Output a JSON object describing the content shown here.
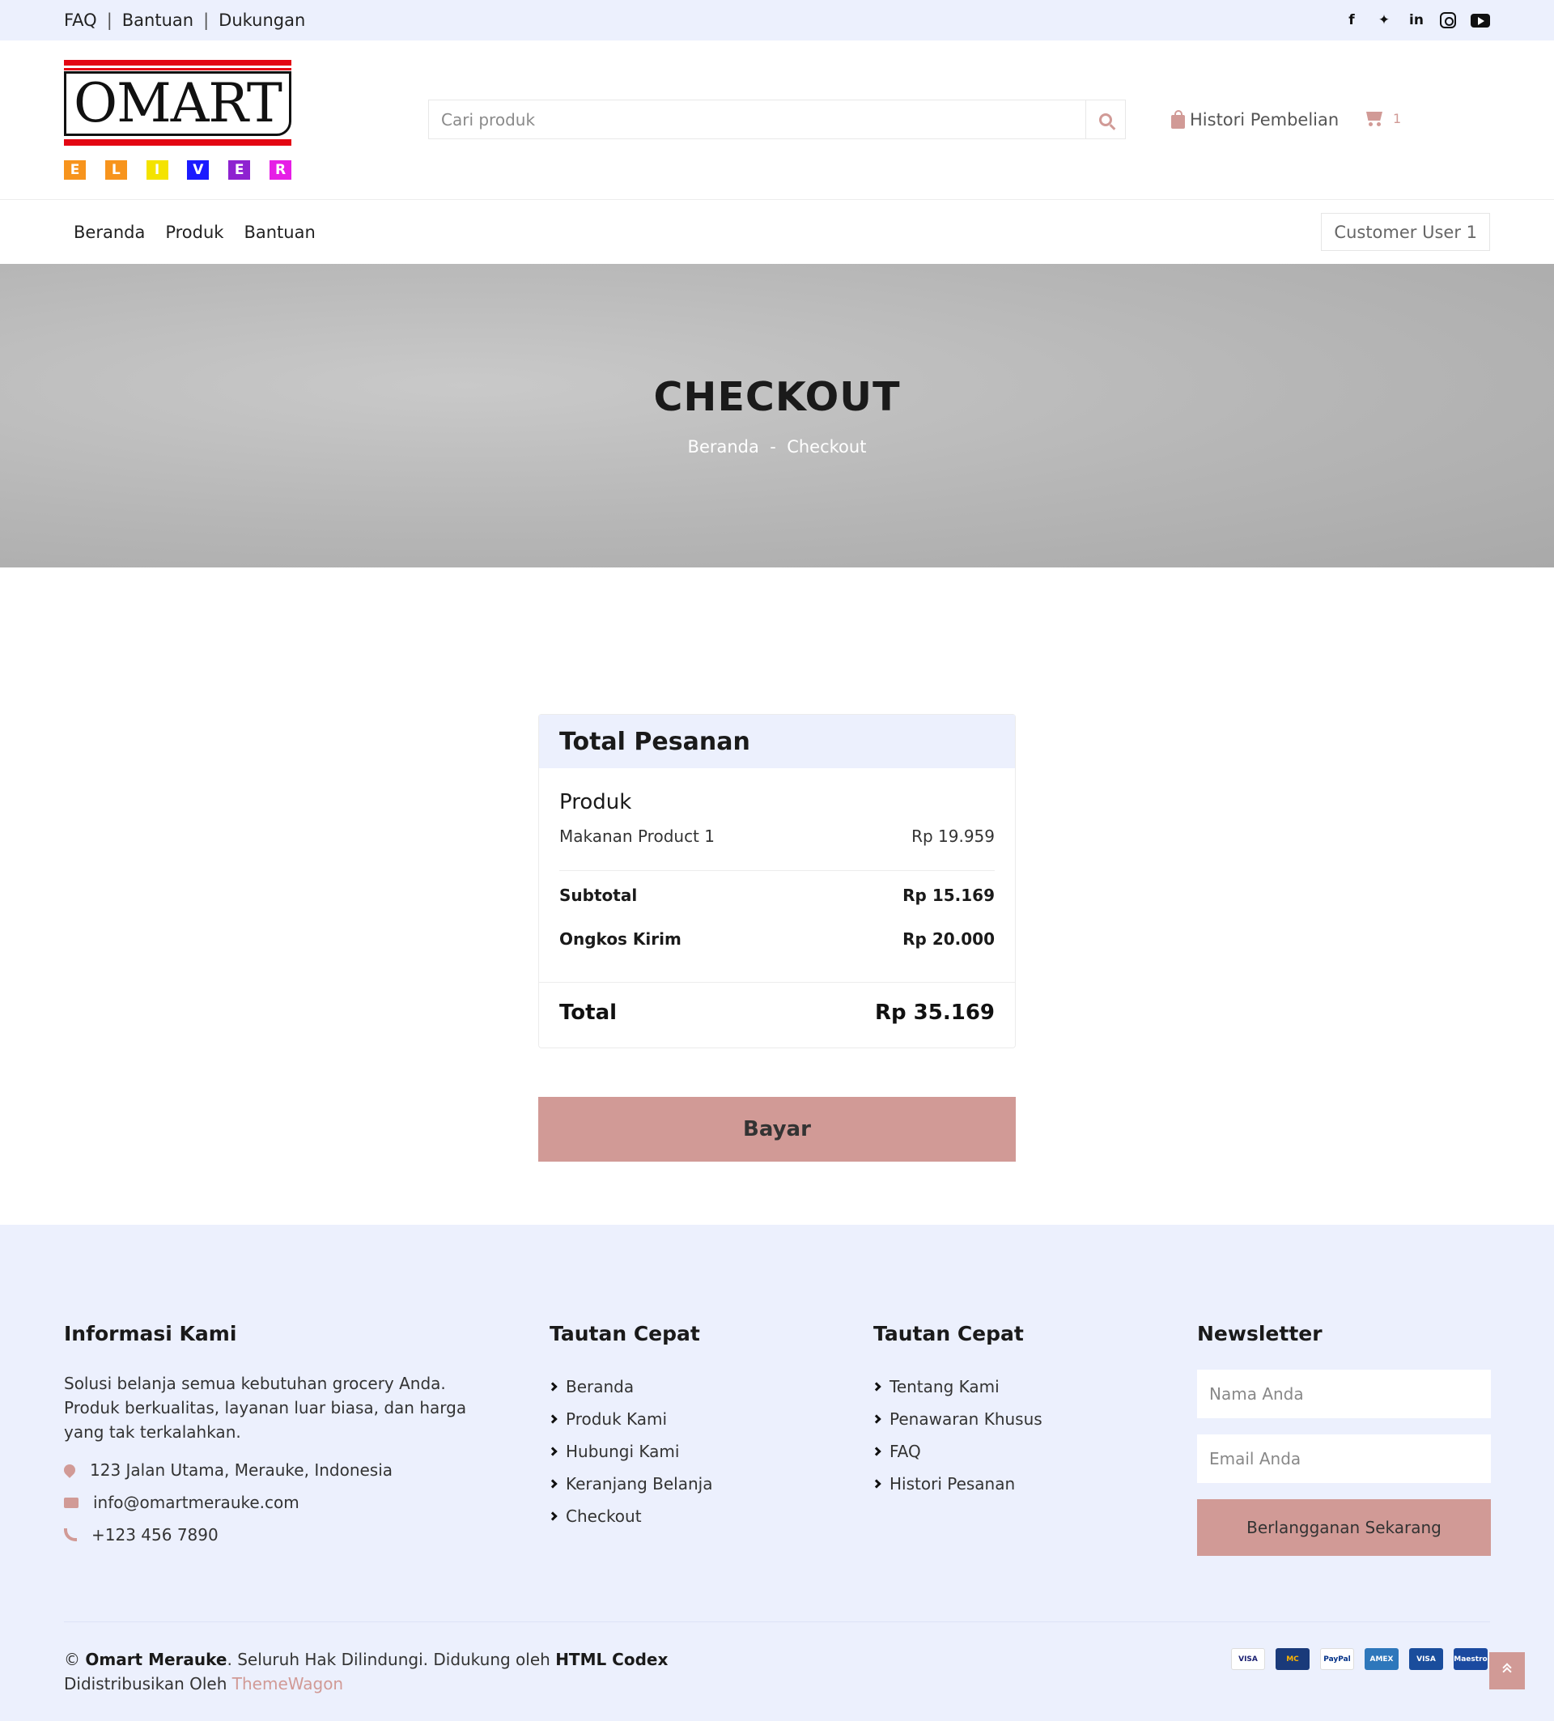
{
  "topbar": {
    "links": [
      "FAQ",
      "Bantuan",
      "Dukungan"
    ],
    "social_icons": [
      "facebook-icon",
      "twitter-icon",
      "linkedin-icon",
      "instagram-icon",
      "youtube-icon"
    ]
  },
  "logo": {
    "word": "OMART",
    "letters": [
      "E",
      "L",
      "I",
      "V",
      "E",
      "R"
    ],
    "letter_colors": [
      "#f7941d",
      "#f7941d",
      "#f4e300",
      "#1a1aff",
      "#8e22d0",
      "#e61ee6"
    ]
  },
  "search": {
    "placeholder": "Cari produk"
  },
  "header": {
    "history_label": "Histori Pembelian",
    "cart_count": "1"
  },
  "nav": {
    "links": [
      "Beranda",
      "Produk",
      "Bantuan"
    ],
    "user": "Customer User 1"
  },
  "hero": {
    "title": "CHECKOUT",
    "breadcrumb": [
      "Beranda",
      "-",
      "Checkout"
    ]
  },
  "order": {
    "title": "Total Pesanan",
    "product_heading": "Produk",
    "items": [
      {
        "name": "Makanan Product 1",
        "price": "Rp 19.959"
      }
    ],
    "subtotal_label": "Subtotal",
    "subtotal_value": "Rp 15.169",
    "shipping_label": "Ongkos Kirim",
    "shipping_value": "Rp 20.000",
    "total_label": "Total",
    "total_value": "Rp 35.169",
    "pay_label": "Bayar"
  },
  "footer": {
    "info": {
      "title": "Informasi Kami",
      "description": "Solusi belanja semua kebutuhan grocery Anda. Produk berkualitas, layanan luar biasa, dan harga yang tak terkalahkan.",
      "address": "123 Jalan Utama, Merauke, Indonesia",
      "email": "info@omartmerauke.com",
      "phone": "+123 456 7890"
    },
    "quick1": {
      "title": "Tautan Cepat",
      "links": [
        "Beranda",
        "Produk Kami",
        "Hubungi Kami",
        "Keranjang Belanja",
        "Checkout"
      ]
    },
    "quick2": {
      "title": "Tautan Cepat",
      "links": [
        "Tentang Kami",
        "Penawaran Khusus",
        "FAQ",
        "Histori Pesanan"
      ]
    },
    "newsletter": {
      "title": "Newsletter",
      "name_placeholder": "Nama Anda",
      "email_placeholder": "Email Anda",
      "button": "Berlangganan Sekarang"
    },
    "copyright": {
      "symbol": "©",
      "brand": "Omart Merauke",
      "text": ". Seluruh Hak Dilindungi. Didukung oleh ",
      "powered": "HTML Codex",
      "distributed": "Didistribusikan Oleh ",
      "distributor": "ThemeWagon"
    },
    "payment_cards": [
      "VISA",
      "MC",
      "PayPal",
      "AMEX",
      "VISA",
      "Maestro"
    ]
  }
}
